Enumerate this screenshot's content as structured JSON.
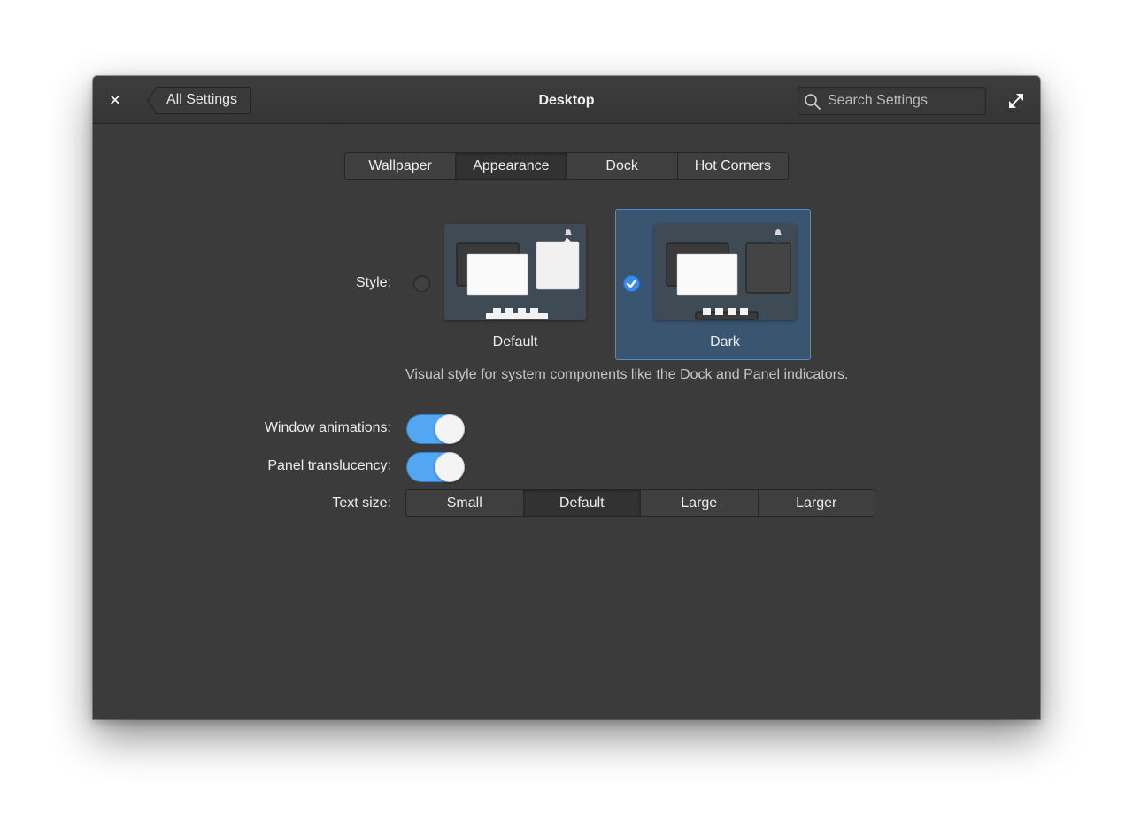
{
  "window": {
    "title": "Desktop",
    "back_label": "All Settings",
    "search_placeholder": "Search Settings"
  },
  "tabs": [
    {
      "label": "Wallpaper",
      "active": false
    },
    {
      "label": "Appearance",
      "active": true
    },
    {
      "label": "Dock",
      "active": false
    },
    {
      "label": "Hot Corners",
      "active": false
    }
  ],
  "appearance": {
    "style_label": "Style:",
    "styles": [
      {
        "name": "Default",
        "selected": false
      },
      {
        "name": "Dark",
        "selected": true
      }
    ],
    "style_description": "Visual style for system components like the Dock and Panel indicators.",
    "window_animations_label": "Window animations:",
    "window_animations_on": true,
    "panel_translucency_label": "Panel translucency:",
    "panel_translucency_on": true,
    "text_size_label": "Text size:",
    "text_sizes": [
      {
        "label": "Small",
        "active": false
      },
      {
        "label": "Default",
        "active": true
      },
      {
        "label": "Large",
        "active": false
      },
      {
        "label": "Larger",
        "active": false
      }
    ]
  },
  "colors": {
    "accent": "#52a6f2",
    "selection": "#3a5570",
    "window_bg": "#3b3b3b"
  }
}
